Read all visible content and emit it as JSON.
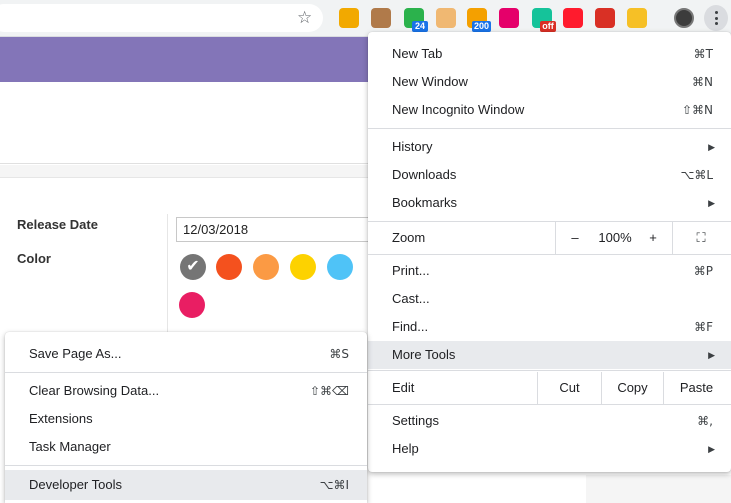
{
  "toolbar": {
    "bookmark_icon": "☆",
    "extensions": [
      {
        "name": "honey-extension-icon",
        "color": "#f2a900",
        "badge": ""
      },
      {
        "name": "monkey-extension-icon",
        "color": "#b07a4a",
        "badge": ""
      },
      {
        "name": "feedly-extension-icon",
        "color": "#2bb24c",
        "badge": "24",
        "badge_color": "#1a73e8"
      },
      {
        "name": "face-extension-icon",
        "color": "#f0b872",
        "badge": ""
      },
      {
        "name": "rss-extension-icon",
        "color": "#f4a000",
        "badge": "200",
        "badge_color": "#1a73e8"
      },
      {
        "name": "t-extension-icon",
        "color": "#e5006a",
        "badge": ""
      },
      {
        "name": "grammarly-extension-icon",
        "color": "#15c39a",
        "badge": "off",
        "badge_color": "#d93025"
      },
      {
        "name": "opera-extension-icon",
        "color": "#ff1b2d",
        "badge": ""
      },
      {
        "name": "book-extension-icon",
        "color": "#d93025",
        "badge": ""
      },
      {
        "name": "pencil-extension-icon",
        "color": "#f6c026",
        "badge": ""
      }
    ]
  },
  "form": {
    "release_date_label": "Release Date",
    "release_date_value": "12/03/2018",
    "color_label": "Color",
    "colors": [
      "#757575",
      "#f4511e",
      "#fb9a44",
      "#fdd200",
      "#4fc3f7",
      "#e91e63"
    ]
  },
  "chrome_menu": {
    "new_tab": {
      "label": "New Tab",
      "shortcut": "⌘T"
    },
    "new_window": {
      "label": "New Window",
      "shortcut": "⌘N"
    },
    "new_incognito": {
      "label": "New Incognito Window",
      "shortcut": "⇧⌘N"
    },
    "history": {
      "label": "History",
      "arrow": "▶"
    },
    "downloads": {
      "label": "Downloads",
      "shortcut": "⌥⌘L"
    },
    "bookmarks": {
      "label": "Bookmarks",
      "arrow": "▶"
    },
    "zoom": {
      "label": "Zoom",
      "minus": "–",
      "level": "100%",
      "plus": "+",
      "fullscreen": "⛶"
    },
    "print": {
      "label": "Print...",
      "shortcut": "⌘P"
    },
    "cast": {
      "label": "Cast..."
    },
    "find": {
      "label": "Find...",
      "shortcut": "⌘F"
    },
    "more_tools": {
      "label": "More Tools",
      "arrow": "▶"
    },
    "edit": {
      "label": "Edit",
      "cut": "Cut",
      "copy": "Copy",
      "paste": "Paste"
    },
    "settings": {
      "label": "Settings",
      "shortcut": "⌘,"
    },
    "help": {
      "label": "Help",
      "arrow": "▶"
    }
  },
  "more_tools_menu": {
    "save_page": {
      "label": "Save Page As...",
      "shortcut": "⌘S"
    },
    "clear_data": {
      "label": "Clear Browsing Data...",
      "shortcut": "⇧⌘⌫"
    },
    "extensions": {
      "label": "Extensions"
    },
    "task_manager": {
      "label": "Task Manager"
    },
    "developer_tools": {
      "label": "Developer Tools",
      "shortcut": "⌥⌘I"
    }
  }
}
